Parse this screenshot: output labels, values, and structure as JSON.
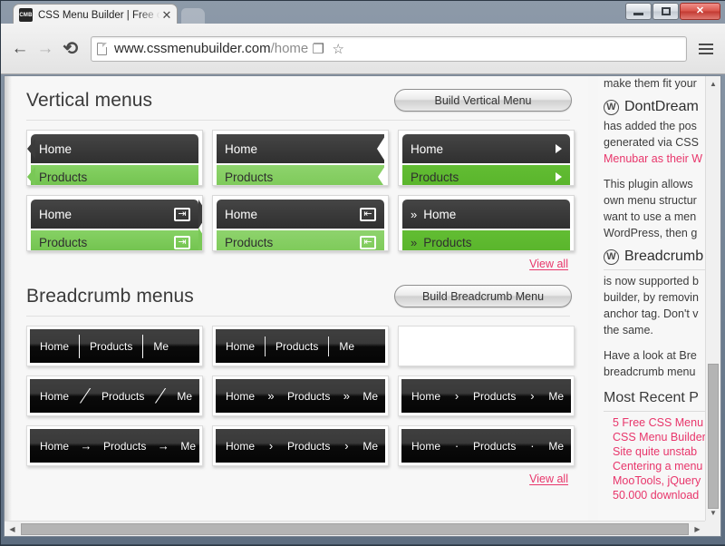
{
  "window": {
    "minimize_label": "Minimize",
    "maximize_label": "Maximize",
    "close_label": "✕"
  },
  "browser": {
    "tab": {
      "favicon_text": "CMB",
      "title": "CSS Menu Builder | Free on",
      "close_glyph": "✕"
    },
    "nav": {
      "back_glyph": "←",
      "forward_glyph": "→",
      "reload_glyph": "⟳"
    },
    "omnibox": {
      "url_main": "www.cssmenubuilder.com",
      "url_path": "/home",
      "translate_glyph": "❐",
      "star_glyph": "☆"
    }
  },
  "page": {
    "vertical_section": {
      "title": "Vertical menus",
      "build_button": "Build Vertical Menu",
      "view_all": "View all",
      "cards": [
        {
          "home": "Home",
          "products": "Products",
          "style": "notch-left"
        },
        {
          "home": "Home",
          "products": "Products",
          "style": "cut-right"
        },
        {
          "home": "Home",
          "products": "Products",
          "style": "tri-right"
        },
        {
          "home": "Home",
          "products": "Products",
          "style": "badge-right",
          "badge_glyph": "⇥"
        },
        {
          "home": "Home",
          "products": "Products",
          "style": "badge-left",
          "badge_glyph": "⇤"
        },
        {
          "home": "Home",
          "products": "Products",
          "style": "chevron-prefix",
          "prefix_glyph": "»"
        }
      ]
    },
    "breadcrumb_section": {
      "title": "Breadcrumb menus",
      "build_button": "Build Breadcrumb Menu",
      "view_all": "View all",
      "cards": [
        {
          "items": [
            "Home",
            "Products",
            "Me"
          ],
          "separator": "bar",
          "sep_glyph": ""
        },
        {
          "items": [
            "Home",
            "Products",
            "Me"
          ],
          "separator": "bar-thin",
          "sep_glyph": ""
        },
        {
          "items": [],
          "separator": "none",
          "sep_glyph": "",
          "empty": true
        },
        {
          "items": [
            "Home",
            "Products",
            "Me"
          ],
          "separator": "slash",
          "sep_glyph": "⟋"
        },
        {
          "items": [
            "Home",
            "Products",
            "Me"
          ],
          "separator": "dbl",
          "sep_glyph": "»"
        },
        {
          "items": [
            "Home",
            "Products",
            "Me"
          ],
          "separator": "gt",
          "sep_glyph": "›"
        },
        {
          "items": [
            "Home",
            "Products",
            "Me"
          ],
          "separator": "arrow",
          "sep_glyph": "→"
        },
        {
          "items": [
            "Home",
            "Products",
            "Me"
          ],
          "separator": "gt",
          "sep_glyph": "›"
        },
        {
          "items": [
            "Home",
            "Products",
            "Me"
          ],
          "separator": "dot",
          "sep_glyph": "·"
        }
      ]
    }
  },
  "sidebar": {
    "top_fragment": "make them fit your",
    "posts": [
      {
        "logo": "W",
        "title": "DontDream",
        "lines": [
          {
            "text": "has added the pos",
            "pink": false
          },
          {
            "text": "generated via CSS",
            "pink": false
          },
          {
            "text": "Menubar as their W",
            "pink": true
          }
        ],
        "paragraph": [
          "This plugin allows ",
          "own menu structur",
          "want to use a men",
          "WordPress, then g"
        ]
      },
      {
        "logo": "W",
        "title": "Breadcrumb",
        "lines": [
          {
            "text": "is now supported b",
            "pink": false
          },
          {
            "text": "builder, by removin",
            "pink": false
          },
          {
            "text": "anchor tag. Don't v",
            "pink": false
          },
          {
            "text": "the same.",
            "pink": false
          }
        ],
        "paragraph": [
          "Have a look at Bre",
          "breadcrumb menu "
        ]
      }
    ],
    "recent_heading": "Most Recent P",
    "recent_posts": [
      "5 Free CSS Menu",
      "CSS Menu Builder",
      "Site quite unstab",
      "Centering a menu",
      "MooTools, jQuery",
      "50.000 download"
    ]
  },
  "scrollbars": {
    "v_up": "▲",
    "v_down": "▼",
    "h_left": "◀",
    "h_right": "▶"
  },
  "colors": {
    "accent_green": "#6fc04b",
    "accent_green_dark": "#59b42b",
    "link_pink": "#e8366b",
    "menu_dark": "#3b3b3b"
  }
}
